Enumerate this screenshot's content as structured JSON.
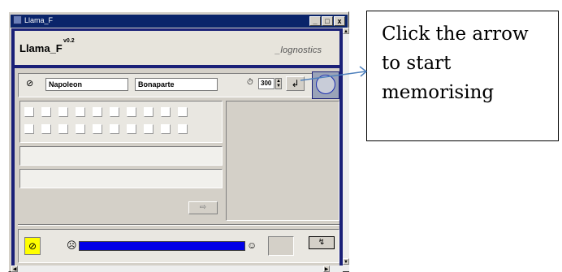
{
  "window": {
    "title": "Llama_F",
    "caption_min": "_",
    "caption_max": "□",
    "caption_close": "x"
  },
  "header": {
    "app_name": "Llama_F",
    "version": "v0.2",
    "brand": "_lognostics"
  },
  "inputs": {
    "first_name": "Napoleon",
    "last_name": "Bonaparte",
    "timer_value": "300"
  },
  "icons": {
    "hide": "eye-slash-icon",
    "timer": "clock-icon",
    "start": "arrow-icon",
    "sad": "sad-face-icon",
    "happy": "happy-face-icon",
    "next": "next-arrow-icon",
    "play": "play-icon"
  },
  "glyphs": {
    "hide": "⊘",
    "timer": "⏱",
    "spin_up": "▲",
    "spin_down": "▼",
    "start": "↲",
    "next": "⇨",
    "sad": "☹",
    "happy": "☺",
    "play": "↯",
    "scroll_up": "▲",
    "scroll_down": "▼",
    "scroll_left": "◀",
    "scroll_right": "▶"
  },
  "grid": {
    "rows": 2,
    "columns": 10
  },
  "progress": {
    "value": 1.0,
    "color": "#0000e6"
  },
  "callout": {
    "text": "Click the arrow to start memorising",
    "arrow_color": "#4f81bd"
  }
}
